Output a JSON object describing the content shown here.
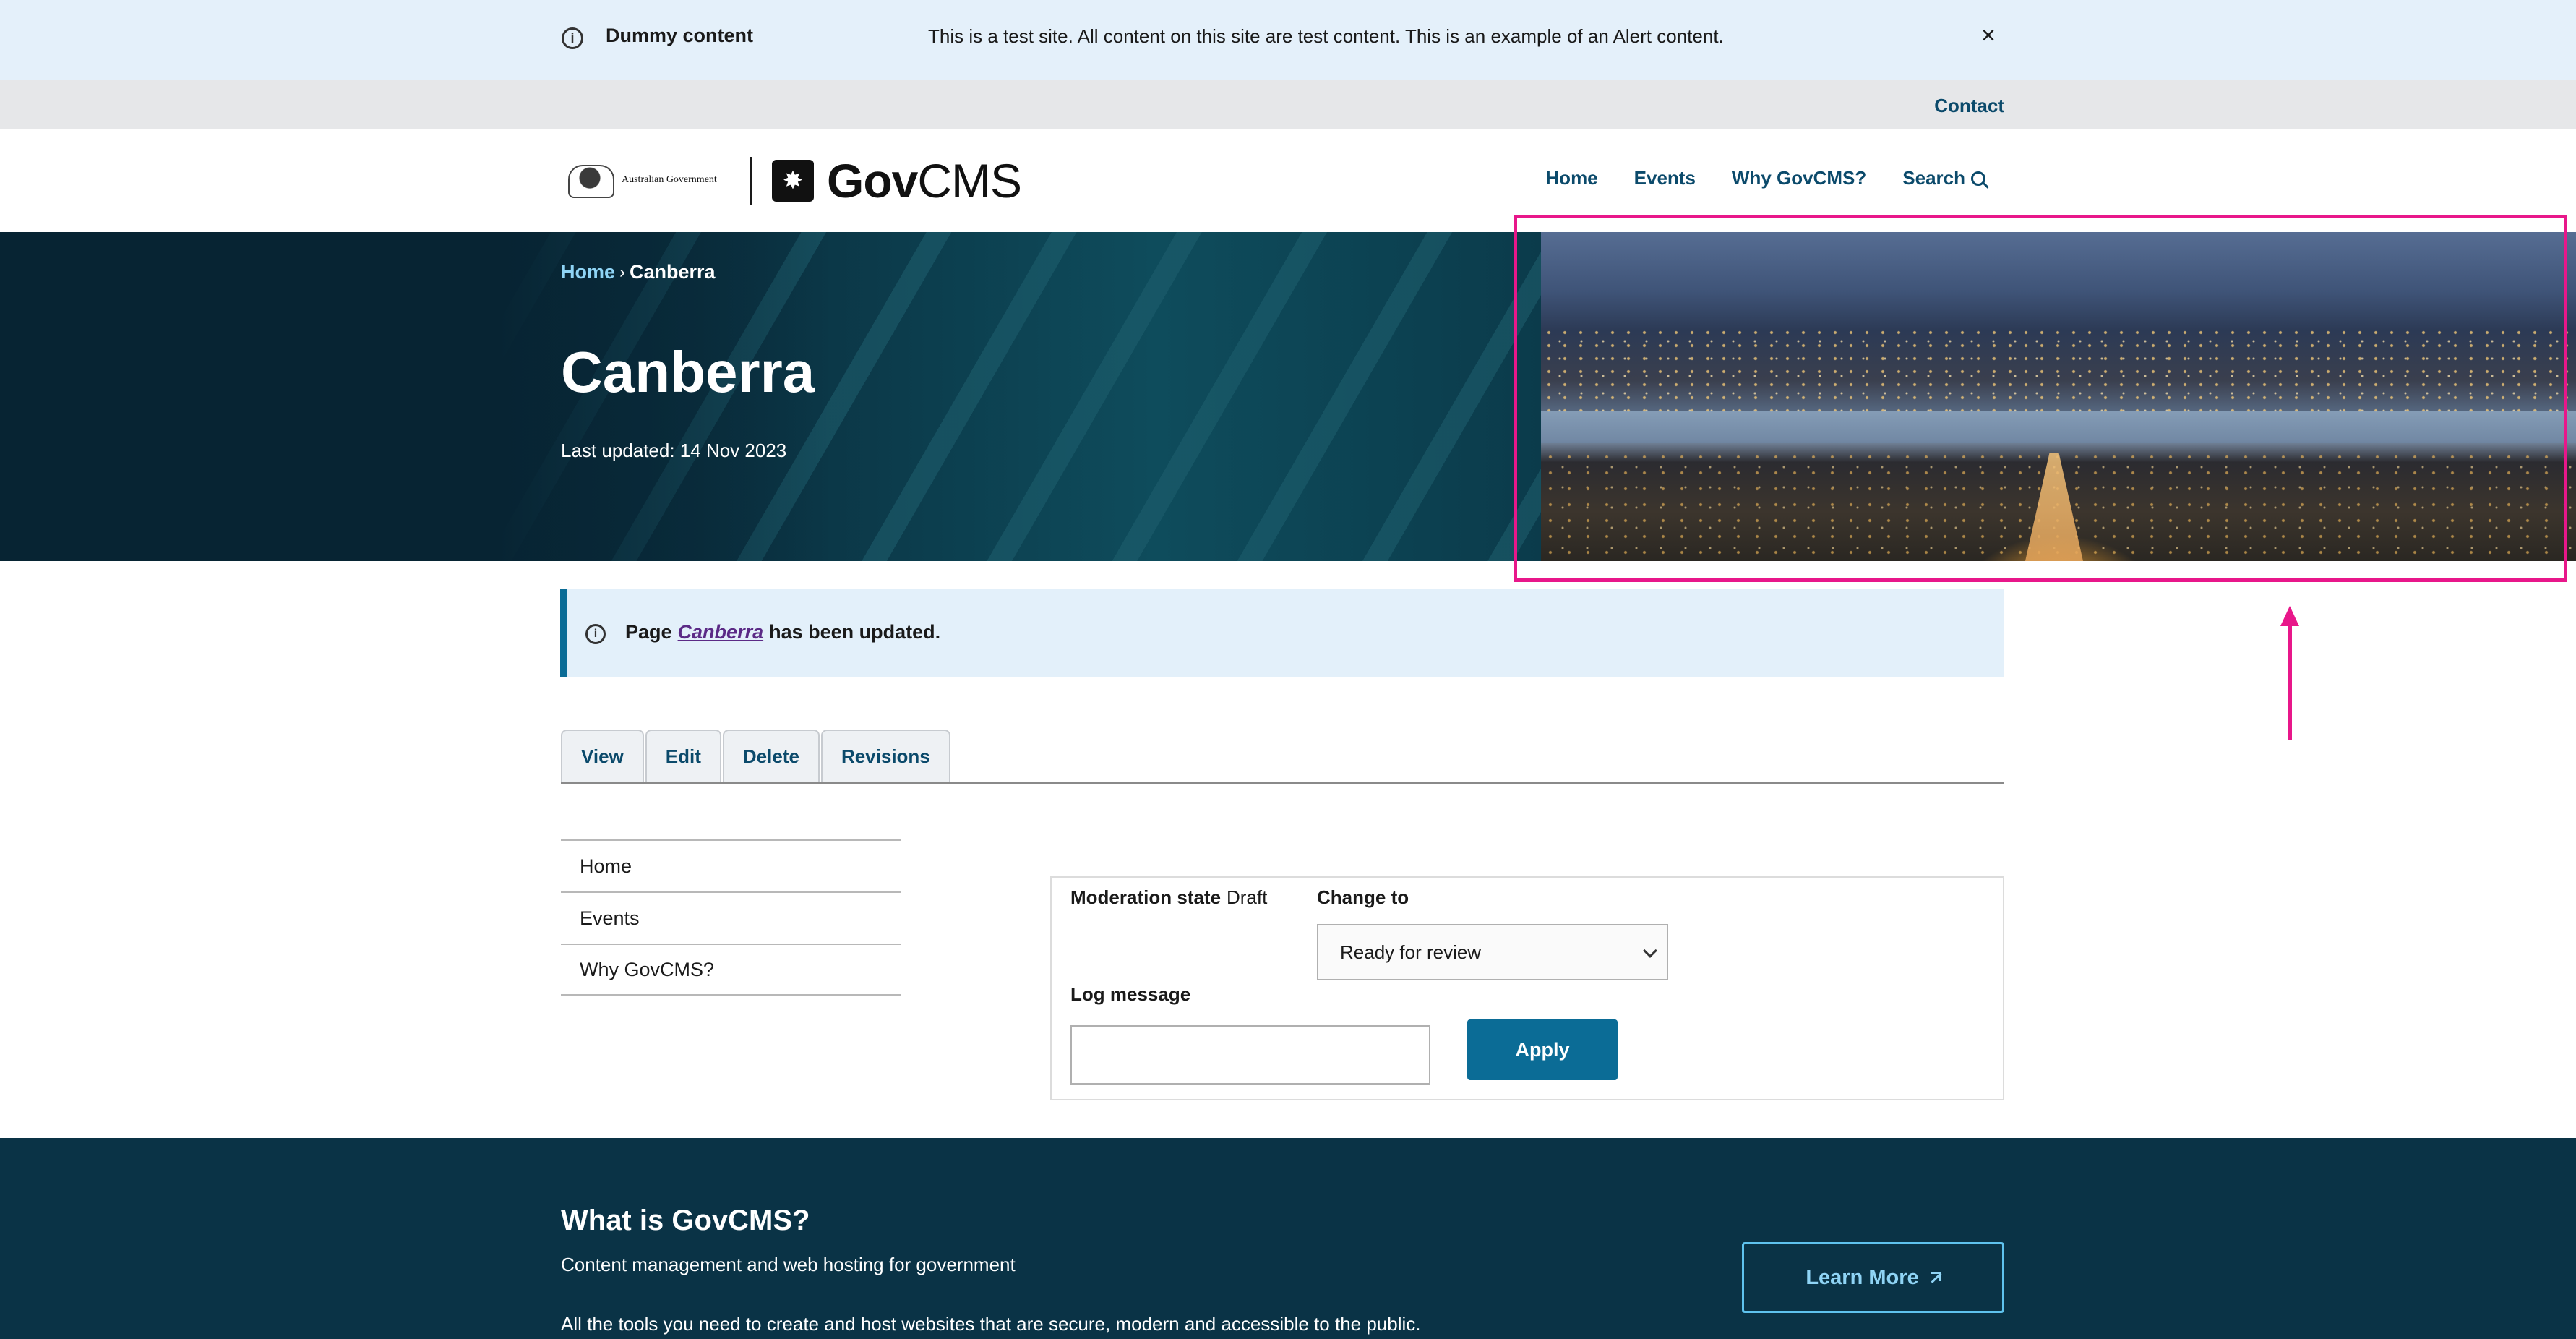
{
  "alert": {
    "title": "Dummy content",
    "message": "This is a test site. All content on this site are test content. This is an example of an Alert content.",
    "close_icon": "close-icon",
    "info_icon": "info-icon"
  },
  "utility_nav": {
    "contact_label": "Contact"
  },
  "header": {
    "crest_text": "Australian Government",
    "logo_word_bold": "Gov",
    "logo_word_light": "CMS",
    "nav": [
      "Home",
      "Events",
      "Why GovCMS?"
    ],
    "search_label": "Search"
  },
  "hero": {
    "breadcrumb_home": "Home",
    "breadcrumb_sep": "›",
    "breadcrumb_current": "Canberra",
    "title": "Canberra",
    "last_updated": "Last updated: 14 Nov 2023"
  },
  "status": {
    "prefix": "Page",
    "link": "Canberra",
    "suffix": "has been updated."
  },
  "tabs": [
    "View",
    "Edit",
    "Delete",
    "Revisions"
  ],
  "side_menu": [
    "Home",
    "Events",
    "Why GovCMS?"
  ],
  "moderation": {
    "state_label": "Moderation state",
    "state_value": "Draft",
    "change_label": "Change to",
    "selected_option": "Ready for review",
    "log_label": "Log message",
    "log_value": "",
    "apply_label": "Apply"
  },
  "footer_promo": {
    "title": "What is GovCMS?",
    "subtitle": "Content management and web hosting for government",
    "body": "All the tools you need to create and host websites that are secure, modern and accessible to the public.",
    "cta_label": "Learn More"
  },
  "colors": {
    "primary": "#0b6c96",
    "nav_text": "#0b4a6b",
    "hero_bg": "#0a2e3e",
    "annotation": "#e8178a"
  }
}
